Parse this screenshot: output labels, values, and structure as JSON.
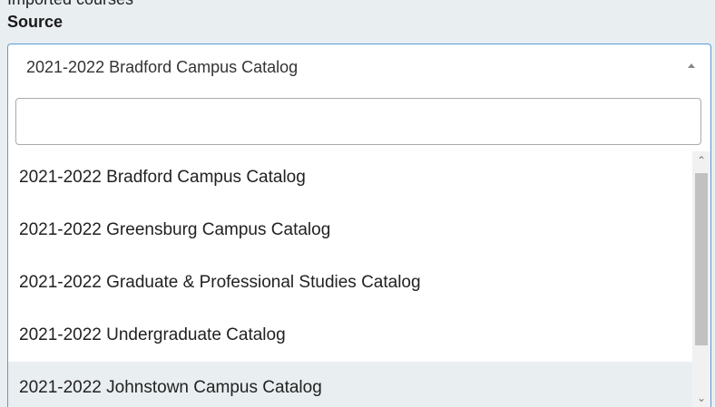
{
  "header": {
    "cut_text": "Imported courses",
    "label": "Source"
  },
  "select": {
    "value": "2021-2022 Bradford Campus Catalog",
    "arrow_icon": "caret-up-icon"
  },
  "search": {
    "value": "",
    "placeholder": ""
  },
  "options": [
    {
      "label": "2021-2022 Bradford Campus Catalog"
    },
    {
      "label": "2021-2022 Greensburg Campus Catalog"
    },
    {
      "label": "2021-2022 Graduate & Professional Studies Catalog"
    },
    {
      "label": "2021-2022 Undergraduate Catalog"
    },
    {
      "label": "2021-2022 Johnstown Campus Catalog"
    }
  ],
  "scrollbar": {
    "up_glyph": "⌃",
    "down_glyph": "⌄",
    "position": 0
  },
  "colors": {
    "focus_border": "#5b9bd5",
    "highlight_bg": "#e9eef1",
    "page_bg": "#e9eef1"
  }
}
